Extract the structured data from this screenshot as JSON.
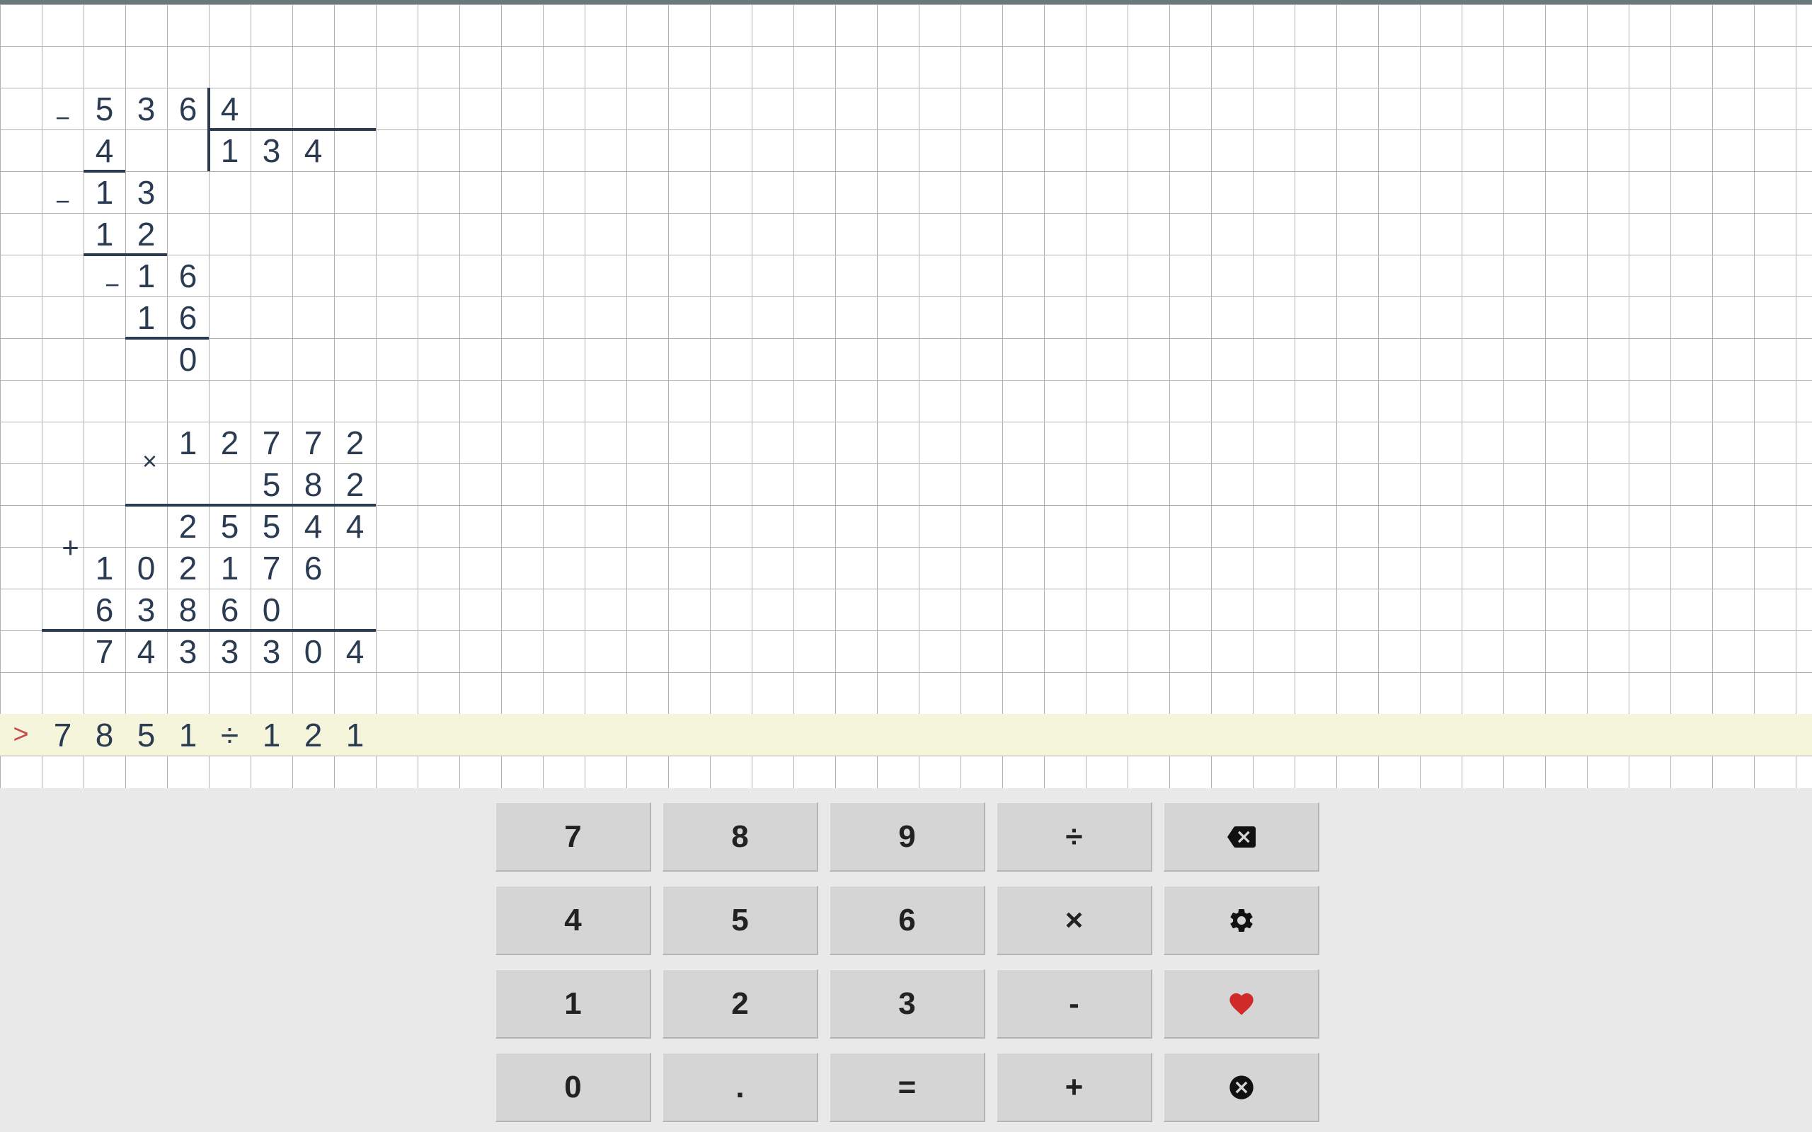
{
  "division": {
    "dividend": [
      "5",
      "3",
      "6"
    ],
    "divisor": "4",
    "quotient": [
      "1",
      "3",
      "4"
    ],
    "steps": [
      {
        "minus_row": 0,
        "sub": [
          "4"
        ],
        "sub_col_start": 2,
        "line_from": 2,
        "line_to": 3
      },
      {
        "pair_top": [
          "1",
          "3"
        ],
        "pair_top_col": 2,
        "minus_row": 2,
        "sub": [
          "1",
          "2"
        ],
        "sub_col_start": 2,
        "line_from": 2,
        "line_to": 4
      },
      {
        "pair_top": [
          "1",
          "6"
        ],
        "pair_top_col": 3,
        "minus_row": 4,
        "sub": [
          "1",
          "6"
        ],
        "sub_col_start": 3,
        "line_from": 3,
        "line_to": 5
      },
      {
        "remainder": "0",
        "col": 4
      }
    ]
  },
  "multiplication": {
    "multiplicand": [
      "1",
      "2",
      "7",
      "7",
      "2"
    ],
    "multiplier": [
      "5",
      "8",
      "2"
    ],
    "op": "×",
    "partials": [
      [
        "2",
        "5",
        "5",
        "4",
        "4"
      ],
      [
        "1",
        "0",
        "2",
        "1",
        "7",
        "6"
      ],
      [
        "6",
        "3",
        "8",
        "6",
        "0"
      ]
    ],
    "plus": "+",
    "result": [
      "7",
      "4",
      "3",
      "3",
      "3",
      "0",
      "4"
    ]
  },
  "input": {
    "prompt": ">",
    "expression": [
      "7",
      "8",
      "5",
      "1",
      "÷",
      "1",
      "2",
      "1"
    ]
  },
  "keypad": {
    "rows": [
      [
        {
          "label": "7",
          "name": "key-7"
        },
        {
          "label": "8",
          "name": "key-8"
        },
        {
          "label": "9",
          "name": "key-9"
        },
        {
          "label": "÷",
          "name": "key-divide"
        },
        {
          "label": "backspace",
          "name": "key-backspace",
          "icon": "backspace"
        }
      ],
      [
        {
          "label": "4",
          "name": "key-4"
        },
        {
          "label": "5",
          "name": "key-5"
        },
        {
          "label": "6",
          "name": "key-6"
        },
        {
          "label": "×",
          "name": "key-multiply"
        },
        {
          "label": "settings",
          "name": "key-settings",
          "icon": "gear"
        }
      ],
      [
        {
          "label": "1",
          "name": "key-1"
        },
        {
          "label": "2",
          "name": "key-2"
        },
        {
          "label": "3",
          "name": "key-3"
        },
        {
          "label": "-",
          "name": "key-minus"
        },
        {
          "label": "favorite",
          "name": "key-favorite",
          "icon": "heart"
        }
      ],
      [
        {
          "label": "0",
          "name": "key-0"
        },
        {
          "label": ".",
          "name": "key-dot"
        },
        {
          "label": "=",
          "name": "key-equals"
        },
        {
          "label": "+",
          "name": "key-plus"
        },
        {
          "label": "clear",
          "name": "key-clear",
          "icon": "clear"
        }
      ]
    ]
  }
}
